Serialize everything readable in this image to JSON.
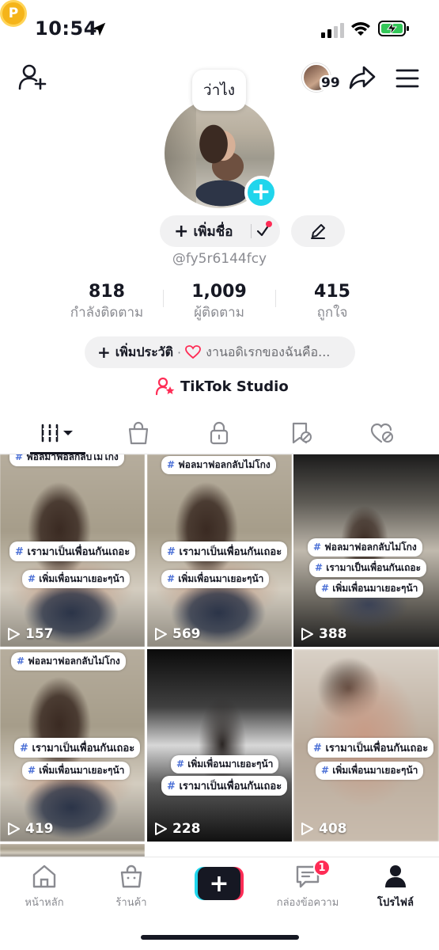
{
  "status_bar": {
    "time": "10:54"
  },
  "header": {
    "visitors_count": "99",
    "status_bubble": "ว่าไง"
  },
  "profile": {
    "add_name_label": "เพิ่มชื่อ",
    "username": "@fy5r6144fcy",
    "stats": [
      {
        "value": "818",
        "label": "กำลังติดตาม"
      },
      {
        "value": "1,009",
        "label": "ผู้ติดตาม"
      },
      {
        "value": "415",
        "label": "ถูกใจ"
      }
    ],
    "bio_add_label": "เพิ่มประวัติ",
    "bio_dot": "·",
    "bio_text": "งานอดิเรกของฉันคือ...",
    "studio_label": "TikTok Studio"
  },
  "tabs": [
    "videos-grid-icon",
    "shop-bag-icon",
    "lock-icon",
    "saved-bookmark-icon",
    "liked-heart-icon"
  ],
  "videos": [
    {
      "views": "157",
      "tags": [
        "ฟอลมาฟอลกลับไม่โกง",
        "เรามาเป็นเพื่อนกันเถอะ",
        "เพิ่มเพื่อนมาเยอะๆน้า"
      ]
    },
    {
      "views": "569",
      "tags": [
        "ฟอลมาฟอลกลับไม่โกง",
        "เรามาเป็นเพื่อนกันเถอะ",
        "เพิ่มเพื่อนมาเยอะๆน้า"
      ]
    },
    {
      "views": "388",
      "tags": [
        "ฟอลมาฟอลกลับไม่โกง",
        "เรามาเป็นเพื่อนกันเถอะ",
        "เพิ่มเพื่อนมาเยอะๆน้า"
      ]
    },
    {
      "views": "419",
      "tags": [
        "ฟอลมาฟอลกลับไม่โกง",
        "เรามาเป็นเพื่อนกันเถอะ",
        "เพิ่มเพื่อนมาเยอะๆน้า"
      ]
    },
    {
      "views": "228",
      "tags": [
        "เพิ่มเพื่อนมาเยอะๆน้า",
        "เรามาเป็นเพื่อนกันเถอะ"
      ]
    },
    {
      "views": "408",
      "tags": [
        "เรามาเป็นเพื่อนกันเถอะ",
        "เพิ่มเพื่อนมาเยอะๆน้า"
      ]
    }
  ],
  "bottom_nav": {
    "home": "หน้าหลัก",
    "shop": "ร้านค้า",
    "inbox": "กล่องข้อความ",
    "inbox_badge": "1",
    "profile": "โปรไฟล์"
  },
  "colors": {
    "accent": "#fe2c55",
    "cyan": "#20d5ec",
    "coin": "#f5b41a"
  }
}
